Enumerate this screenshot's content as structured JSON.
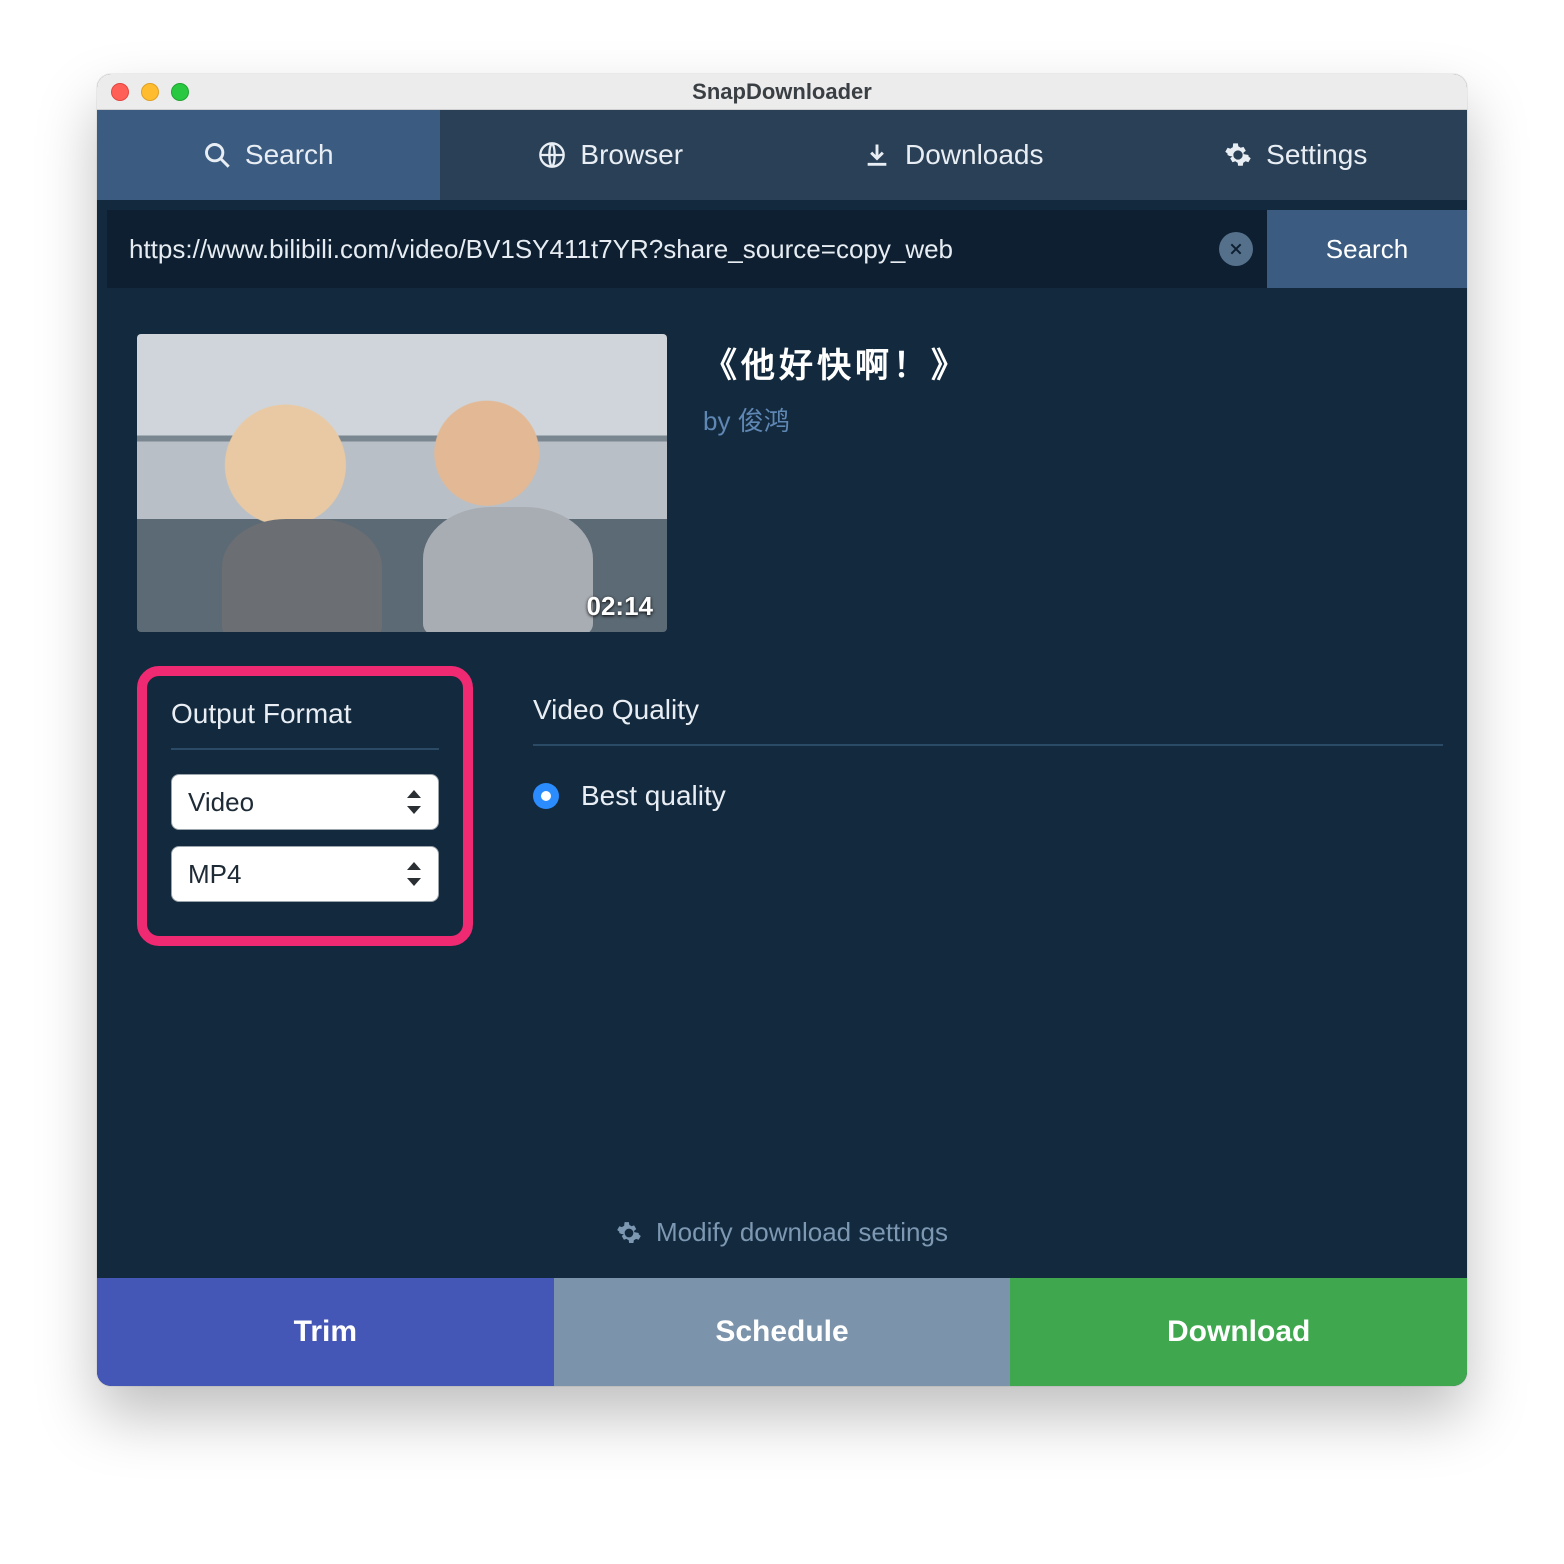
{
  "window": {
    "title": "SnapDownloader"
  },
  "tabs": {
    "search": "Search",
    "browser": "Browser",
    "downloads": "Downloads",
    "settings": "Settings"
  },
  "urlbar": {
    "value": "https://www.bilibili.com/video/BV1SY411t7YR?share_source=copy_web",
    "search_label": "Search"
  },
  "video": {
    "title": "《他好快啊！》",
    "by_prefix": "by ",
    "author": "俊鸿",
    "duration": "02:14"
  },
  "sections": {
    "output_format": "Output Format",
    "video_quality": "Video Quality"
  },
  "selects": {
    "type": "Video",
    "container": "MP4"
  },
  "quality": {
    "best": "Best quality"
  },
  "modify_settings": "Modify download settings",
  "actions": {
    "trim": "Trim",
    "schedule": "Schedule",
    "download": "Download"
  }
}
